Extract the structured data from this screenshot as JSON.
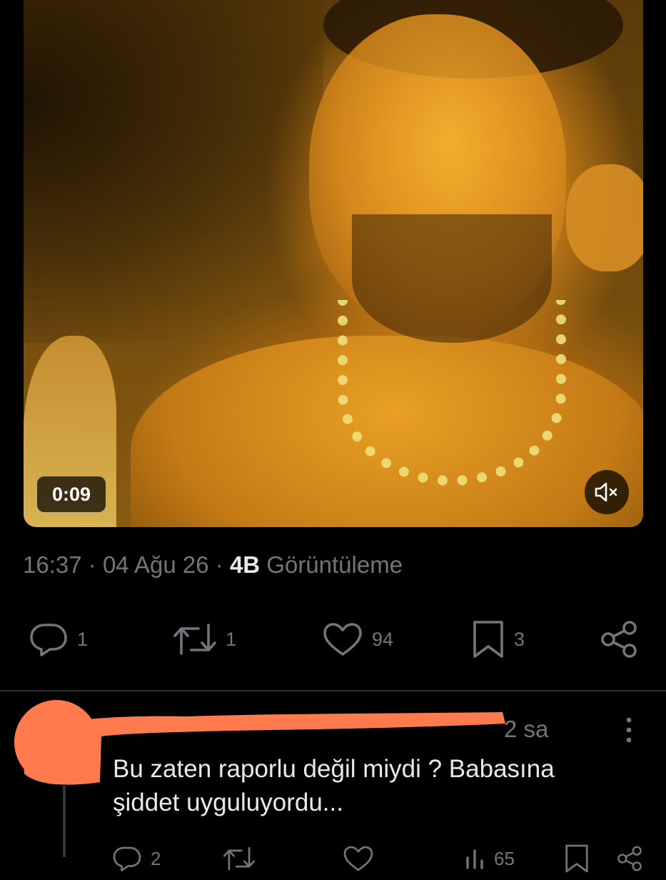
{
  "video": {
    "timer": "0:09",
    "mute_icon": "speaker-muted-icon"
  },
  "tweet_meta": {
    "time": "16:37",
    "separator": "·",
    "date": "04 Ağu 26",
    "views_count": "4B",
    "views_label": "Görüntüleme"
  },
  "actions": {
    "reply_count": "1",
    "retweet_count": "1",
    "like_count": "94",
    "bookmark_count": "3",
    "icons": [
      "reply-icon",
      "retweet-icon",
      "like-icon",
      "bookmark-icon",
      "share-icon"
    ]
  },
  "reply": {
    "time": "2 sa",
    "text_line1": "Bu zaten raporlu değil miydi ? Babasına",
    "text_line2": "şiddet uyguluyordu...",
    "reply_count": "2",
    "views_count": "65"
  },
  "colors": {
    "background": "#000000",
    "text_primary": "#e7e9ea",
    "text_secondary": "#71767b",
    "divider": "#2f3336",
    "redaction": "#ff7a4d"
  }
}
